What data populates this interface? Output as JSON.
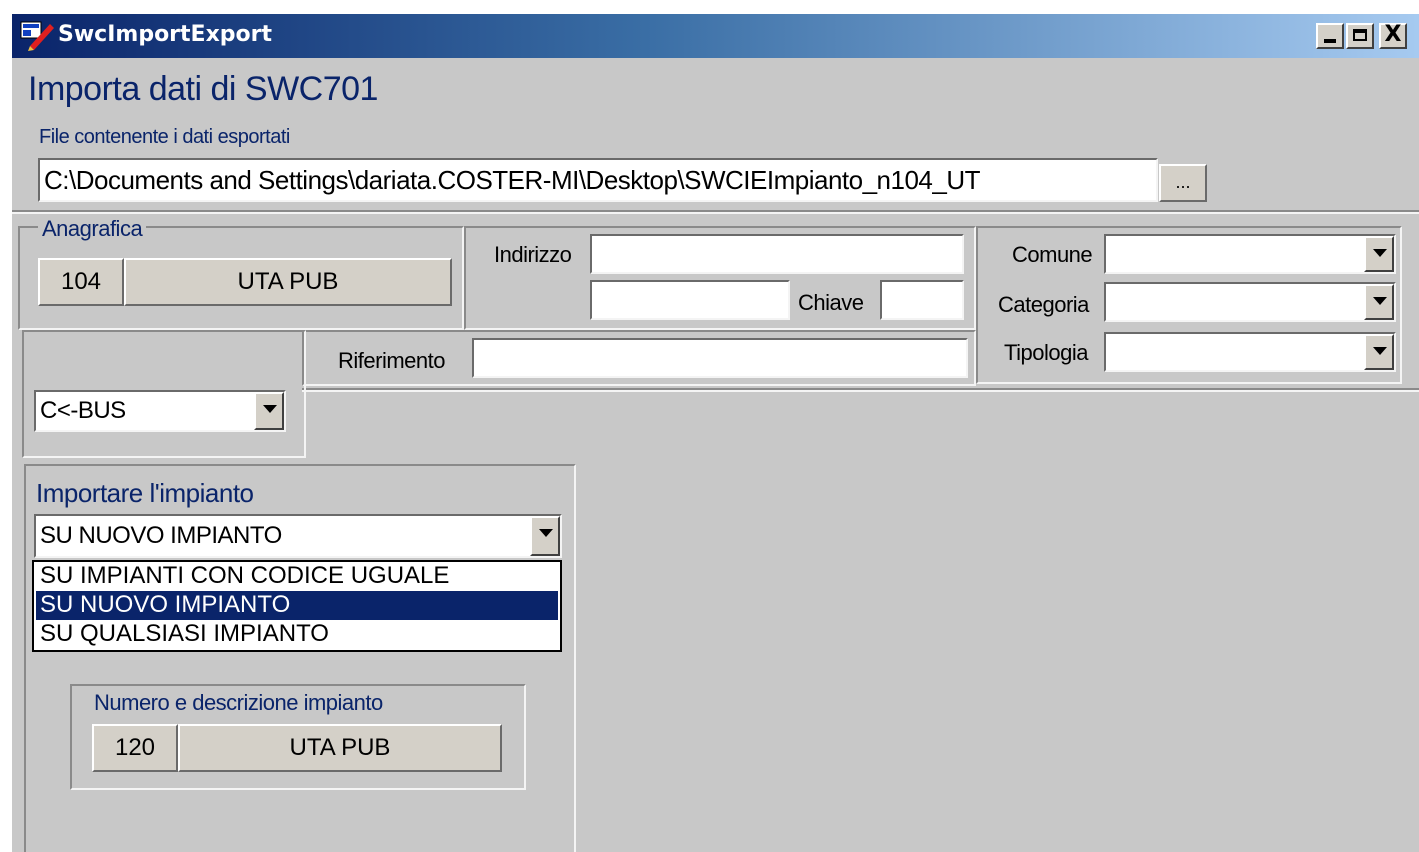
{
  "window": {
    "title": "SwcImportExport",
    "controls": [
      "minimize-icon",
      "maximize-icon",
      "close-icon"
    ],
    "close_glyph": "X"
  },
  "header": {
    "heading": "Importa dati di SWC701",
    "file_label": "File contenente i dati esportati",
    "file_path": "C:\\Documents and Settings\\dariata.COSTER-MI\\Desktop\\SWCIEImpianto_n104_UT",
    "browse_label": "..."
  },
  "anagrafica": {
    "group_label": "Anagrafica",
    "code": "104",
    "name": "UTA PUB",
    "indirizzo_label": "Indirizzo",
    "indirizzo_value": "",
    "indirizzo2_value": "",
    "chiave_label": "Chiave",
    "chiave_value": "",
    "riferimento_label": "Riferimento",
    "riferimento_value": "",
    "comune_label": "Comune",
    "comune_value": "",
    "categoria_label": "Categoria",
    "categoria_value": "",
    "tipologia_label": "Tipologia",
    "tipologia_value": ""
  },
  "bus": {
    "selected": "C<-BUS"
  },
  "import": {
    "label": "Importare l'impianto",
    "selected": "SU NUOVO IMPIANTO",
    "options": [
      "SU IMPIANTI CON CODICE UGUALE",
      "SU NUOVO IMPIANTO",
      "SU QUALSIASI IMPIANTO"
    ],
    "highlighted_index": 1
  },
  "impianto": {
    "label": "Numero e descrizione impianto",
    "number": "120",
    "description": "UTA PUB"
  },
  "colors": {
    "titlebar_start": "#0a246a",
    "titlebar_end": "#a6caf0",
    "face": "#c8c8c8",
    "highlight": "#0a246a",
    "label_blue": "#0a246a"
  }
}
